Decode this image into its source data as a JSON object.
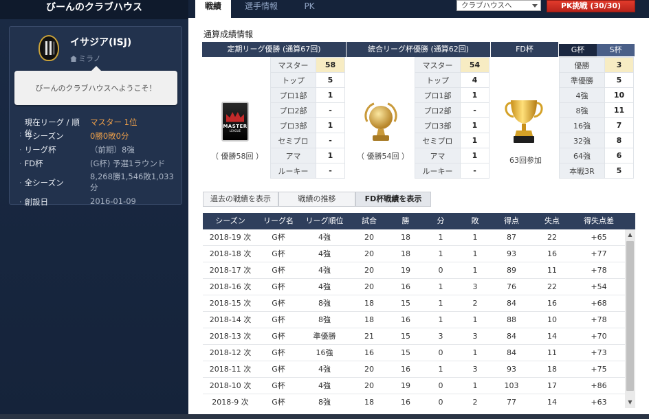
{
  "sidebar": {
    "title": "びーんのクラブハウス",
    "club_name": "イサジア(ISJ)",
    "club_city": "ミラノ",
    "welcome": "びーんのクラブハウスへようこそ！",
    "info": [
      {
        "label": "現在リーグ / 順位",
        "value": "マスター 1位"
      },
      {
        "label": "今シーズン",
        "value": "0勝0敗0分"
      },
      {
        "label": "リーグ杯",
        "value": "（前期）8強"
      },
      {
        "label": "FD杯",
        "value": "(G杯) 予選1ラウンド"
      },
      {
        "label": "全シーズン",
        "value": "8,268勝1,546敗1,033分"
      },
      {
        "label": "創設日",
        "value": "2016-01-09"
      }
    ]
  },
  "tabs": {
    "record": "戦績",
    "player_info": "選手情報",
    "pk": "PK",
    "clubhouse_select": "クラブハウスへ",
    "pk_challenge": "PK挑戦 (30/30)"
  },
  "summary": {
    "title": "通算成績情報",
    "league": {
      "header": "定期リーグ優勝 (通算67回)",
      "caption": "（ 優勝58回 ）",
      "rows": [
        {
          "k": "マスター",
          "v": "58"
        },
        {
          "k": "トップ",
          "v": "5"
        },
        {
          "k": "プロ1部",
          "v": "1"
        },
        {
          "k": "プロ2部",
          "v": "-"
        },
        {
          "k": "プロ3部",
          "v": "1"
        },
        {
          "k": "セミプロ",
          "v": "-"
        },
        {
          "k": "アマ",
          "v": "1"
        },
        {
          "k": "ルーキー",
          "v": "-"
        }
      ]
    },
    "cup": {
      "header": "統合リーグ杯優勝 (通算62回)",
      "caption": "（ 優勝54回 ）",
      "rows": [
        {
          "k": "マスター",
          "v": "54"
        },
        {
          "k": "トップ",
          "v": "4"
        },
        {
          "k": "プロ1部",
          "v": "1"
        },
        {
          "k": "プロ2部",
          "v": "-"
        },
        {
          "k": "プロ3部",
          "v": "1"
        },
        {
          "k": "セミプロ",
          "v": "1"
        },
        {
          "k": "アマ",
          "v": "1"
        },
        {
          "k": "ルーキー",
          "v": "-"
        }
      ]
    },
    "fd": {
      "header": "FD杯",
      "tab_g": "G杯",
      "tab_s": "S杯",
      "caption": "63回参加",
      "rows": [
        {
          "k": "優勝",
          "v": "3"
        },
        {
          "k": "準優勝",
          "v": "5"
        },
        {
          "k": "4強",
          "v": "10"
        },
        {
          "k": "8強",
          "v": "11"
        },
        {
          "k": "16強",
          "v": "7"
        },
        {
          "k": "32強",
          "v": "8"
        },
        {
          "k": "64強",
          "v": "6"
        },
        {
          "k": "本戦3R",
          "v": "5"
        }
      ]
    }
  },
  "buttons": {
    "past": "過去の戦績を表示",
    "trend": "戦績の推移",
    "fd": "FD杯戦績を表示"
  },
  "history": {
    "columns": [
      "シーズン",
      "リーグ名",
      "リーグ順位",
      "試合",
      "勝",
      "分",
      "敗",
      "得点",
      "失点",
      "得失点差"
    ],
    "rows": [
      [
        "2018-19 次",
        "G杯",
        "4強",
        "20",
        "18",
        "1",
        "1",
        "87",
        "22",
        "+65"
      ],
      [
        "2018-18 次",
        "G杯",
        "4強",
        "20",
        "18",
        "1",
        "1",
        "93",
        "16",
        "+77"
      ],
      [
        "2018-17 次",
        "G杯",
        "4強",
        "20",
        "19",
        "0",
        "1",
        "89",
        "11",
        "+78"
      ],
      [
        "2018-16 次",
        "G杯",
        "4強",
        "20",
        "16",
        "1",
        "3",
        "76",
        "22",
        "+54"
      ],
      [
        "2018-15 次",
        "G杯",
        "8強",
        "18",
        "15",
        "1",
        "2",
        "84",
        "16",
        "+68"
      ],
      [
        "2018-14 次",
        "G杯",
        "8強",
        "18",
        "16",
        "1",
        "1",
        "88",
        "10",
        "+78"
      ],
      [
        "2018-13 次",
        "G杯",
        "準優勝",
        "21",
        "15",
        "3",
        "3",
        "84",
        "14",
        "+70"
      ],
      [
        "2018-12 次",
        "G杯",
        "16強",
        "16",
        "15",
        "0",
        "1",
        "84",
        "11",
        "+73"
      ],
      [
        "2018-11 次",
        "G杯",
        "4強",
        "20",
        "16",
        "1",
        "3",
        "93",
        "18",
        "+75"
      ],
      [
        "2018-10 次",
        "G杯",
        "4強",
        "20",
        "19",
        "0",
        "1",
        "103",
        "17",
        "+86"
      ],
      [
        "2018-9 次",
        "G杯",
        "8強",
        "18",
        "16",
        "0",
        "2",
        "77",
        "14",
        "+63"
      ]
    ]
  },
  "colors": {
    "navy": "#1a2a44",
    "header": "#2f3f5c",
    "accent_orange": "#f2a24a",
    "pk_red": "#e23b2c",
    "highlight": "#f7ecc3"
  }
}
